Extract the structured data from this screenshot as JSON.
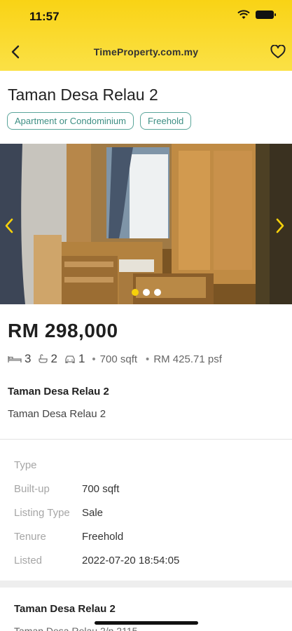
{
  "status_bar": {
    "time": "11:57"
  },
  "nav": {
    "title": "TimeProperty.com.my",
    "back_icon": "chevron-left-icon",
    "favorite_icon": "heart-outline-icon"
  },
  "listing": {
    "title": "Taman Desa Relau 2",
    "tags": [
      "Apartment or Condominium",
      "Freehold"
    ],
    "gallery": {
      "image_count": 3,
      "active_index": 0,
      "accent_color": "#f6d10b"
    },
    "price": "RM 298,000",
    "specs": {
      "bedrooms": "3",
      "bathrooms": "2",
      "parking": "1",
      "size": "700 sqft",
      "psf": "RM 425.71 psf"
    },
    "address_title": "Taman Desa Relau 2",
    "address_sub": "Taman Desa Relau 2"
  },
  "details": {
    "type_label": "Type",
    "type_value": "",
    "builtup_label": "Built-up",
    "builtup_value": "700 sqft",
    "listing_type_label": "Listing Type",
    "listing_type_value": "Sale",
    "tenure_label": "Tenure",
    "tenure_value": "Freehold",
    "listed_label": "Listed",
    "listed_value": "2022-07-20 18:54:05"
  },
  "section2": {
    "title": "Taman Desa Relau 2",
    "subtitle": "Taman Desa Relau 2/n 2115"
  },
  "colors": {
    "header": "#f9d315",
    "tag_border": "#5aa59a",
    "arrow": "#f6d10b"
  }
}
